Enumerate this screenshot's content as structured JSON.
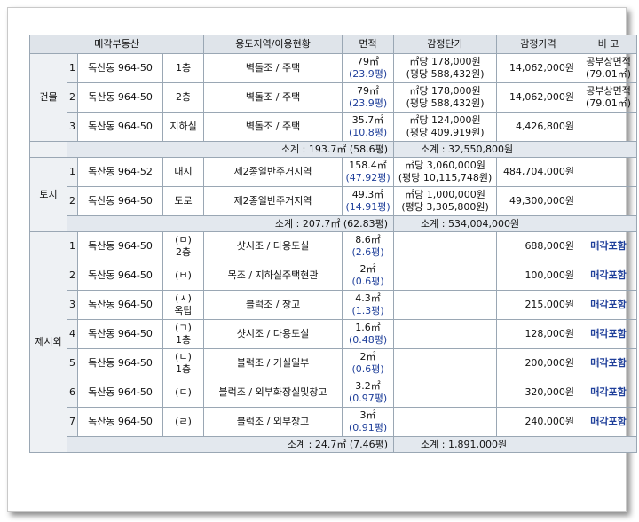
{
  "headers": [
    "매각부동산",
    "용도지역/이용현황",
    "면적",
    "감정단가",
    "감정가격",
    "비 고"
  ],
  "groups": {
    "building": {
      "label": "건물",
      "rows": [
        {
          "no": "1",
          "addr": "독산동 964-50",
          "floor": "1층",
          "use": "벽돌조 / 주택",
          "area": "79㎡",
          "area_py": "(23.9평)",
          "unit1": "㎡당 178,000원",
          "unit2": "(평당 588,432원)",
          "price": "14,062,000원",
          "note1": "공부상면적",
          "note2": "(79.01㎡)"
        },
        {
          "no": "2",
          "addr": "독산동 964-50",
          "floor": "2층",
          "use": "벽돌조 / 주택",
          "area": "79㎡",
          "area_py": "(23.9평)",
          "unit1": "㎡당 178,000원",
          "unit2": "(평당 588,432원)",
          "price": "14,062,000원",
          "note1": "공부상면적",
          "note2": "(79.01㎡)"
        },
        {
          "no": "3",
          "addr": "독산동 964-50",
          "floor": "지하실",
          "use": "벽돌조 / 주택",
          "area": "35.7㎡",
          "area_py": "(10.8평)",
          "unit1": "㎡당 124,000원",
          "unit2": "(평당 409,919원)",
          "price": "4,426,800원",
          "note1": "",
          "note2": ""
        }
      ],
      "sub_area": "소계 : 193.7㎡ (58.6평)",
      "sub_price": "소계 : 32,550,800원"
    },
    "land": {
      "label": "토지",
      "rows": [
        {
          "no": "1",
          "addr": "독산동 964-52",
          "floor": "대지",
          "use": "제2종일반주거지역",
          "area": "158.4㎡",
          "area_py": "(47.92평)",
          "unit1": "㎡당 3,060,000원",
          "unit2": "(평당 10,115,748원)",
          "price": "484,704,000원"
        },
        {
          "no": "2",
          "addr": "독산동 964-50",
          "floor": "도로",
          "use": "제2종일반주거지역",
          "area": "49.3㎡",
          "area_py": "(14.91평)",
          "unit1": "㎡당 1,000,000원",
          "unit2": "(평당 3,305,800원)",
          "price": "49,300,000원"
        }
      ],
      "sub_area": "소계 : 207.7㎡ (62.83평)",
      "sub_price": "소계 : 534,004,000원"
    },
    "excluded": {
      "label": "제시외",
      "rows": [
        {
          "no": "1",
          "addr": "독산동 964-50",
          "mark": "(ㅁ)",
          "floor": "2층",
          "use": "샷시조 / 다용도실",
          "area": "8.6㎡",
          "area_py": "(2.6평)",
          "price": "688,000원",
          "note": "매각포함"
        },
        {
          "no": "2",
          "addr": "독산동 964-50",
          "mark": "(ㅂ)",
          "floor": "",
          "use": "목조 / 지하실주택현관",
          "area": "2㎡",
          "area_py": "(0.6평)",
          "price": "100,000원",
          "note": "매각포함"
        },
        {
          "no": "3",
          "addr": "독산동 964-50",
          "mark": "(ㅅ)",
          "floor": "옥탑",
          "use": "블럭조 / 창고",
          "area": "4.3㎡",
          "area_py": "(1.3평)",
          "price": "215,000원",
          "note": "매각포함"
        },
        {
          "no": "4",
          "addr": "독산동 964-50",
          "mark": "(ㄱ)",
          "floor": "1층",
          "use": "샷시조 / 다용도실",
          "area": "1.6㎡",
          "area_py": "(0.48평)",
          "price": "128,000원",
          "note": "매각포함"
        },
        {
          "no": "5",
          "addr": "독산동 964-50",
          "mark": "(ㄴ)",
          "floor": "1층",
          "use": "블럭조 / 거실일부",
          "area": "2㎡",
          "area_py": "(0.6평)",
          "price": "200,000원",
          "note": "매각포함"
        },
        {
          "no": "6",
          "addr": "독산동 964-50",
          "mark": "(ㄷ)",
          "floor": "",
          "use": "블럭조 / 외부화장실및창고",
          "area": "3.2㎡",
          "area_py": "(0.97평)",
          "price": "320,000원",
          "note": "매각포함"
        },
        {
          "no": "7",
          "addr": "독산동 964-50",
          "mark": "(ㄹ)",
          "floor": "",
          "use": "블럭조 / 외부창고",
          "area": "3㎡",
          "area_py": "(0.91평)",
          "price": "240,000원",
          "note": "매각포함"
        }
      ],
      "sub_area": "소계 : 24.7㎡ (7.46평)",
      "sub_price": "소계 : 1,891,000원"
    }
  },
  "colors": {
    "header_bg": "#dfe4ea",
    "border": "#9aa7b4",
    "pyeong_text": "#1f3f9a"
  }
}
